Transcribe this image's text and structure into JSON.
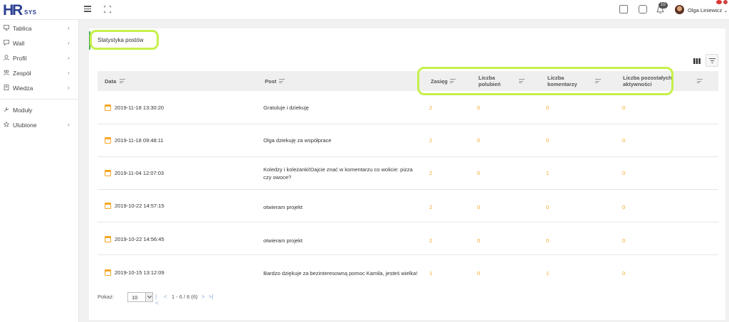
{
  "header": {
    "logo_h": "H",
    "logo_r": "R",
    "logo_sys": "SYS",
    "notifications_count": "10",
    "user_name": "Olga Liniewicz",
    "user_chevron": "⌄"
  },
  "sidebar": {
    "items": [
      {
        "label": "Tablica",
        "icon": "monitor-icon",
        "chevron": "›"
      },
      {
        "label": "Wall",
        "icon": "chat-icon",
        "chevron": "›"
      },
      {
        "label": "Profil",
        "icon": "person-icon",
        "chevron": "›"
      },
      {
        "label": "Zespół",
        "icon": "team-icon",
        "chevron": "›"
      },
      {
        "label": "Wiedza",
        "icon": "book-icon",
        "chevron": "›"
      },
      {
        "label": "Moduły",
        "icon": "wrench-icon",
        "chevron": ""
      },
      {
        "label": "Ulubione",
        "icon": "star-icon",
        "chevron": "›"
      }
    ]
  },
  "page": {
    "title": "Statystyka postów"
  },
  "table": {
    "columns": [
      {
        "label": "Data"
      },
      {
        "label": "Post"
      },
      {
        "label": "Zasięg"
      },
      {
        "label": "Liczba polubień"
      },
      {
        "label": "Liczba komentarzy"
      },
      {
        "label": "Liczba pozostałych aktywności"
      }
    ],
    "rows": [
      {
        "date": "2019-11-18 13:30:20",
        "post": "Gratuluje i dziekuję",
        "reach": "2",
        "likes": "0",
        "comments": "0",
        "other": "0"
      },
      {
        "date": "2019-11-18 09:48:11",
        "post": "Olga dziekuję za współprace",
        "reach": "2",
        "likes": "0",
        "comments": "0",
        "other": "0"
      },
      {
        "date": "2019-11-04 12:07:03",
        "post": "Koledzy i koleżanki!Dajcie znać w komentarzu co wolicie: pizza czy owoce?",
        "reach": "2",
        "likes": "0",
        "comments": "1",
        "other": "0"
      },
      {
        "date": "2019-10-22 14:57:15",
        "post": "otwieram projekt",
        "reach": "2",
        "likes": "0",
        "comments": "0",
        "other": "0"
      },
      {
        "date": "2019-10-22 14:56:45",
        "post": "otwieram projekt",
        "reach": "2",
        "likes": "0",
        "comments": "0",
        "other": "0"
      },
      {
        "date": "2019-10-15 13:12:09",
        "post": "Bardzo dziękuje za bezinteresowną pomoc Kamila, jesteś wielka!",
        "reach": "1",
        "likes": "0",
        "comments": "1",
        "other": "0"
      }
    ]
  },
  "pager": {
    "label": "Pokaż:",
    "page_size": "10",
    "first": "|<",
    "prev": "<",
    "range": "1 - 6 / 6 (6)",
    "next": ">",
    "last": ">|"
  },
  "colors": {
    "accent_orange": "#f5a623",
    "highlight": "#c6f04a",
    "brand_blue": "#2a3d8f",
    "title_bar": "#4caf50"
  }
}
